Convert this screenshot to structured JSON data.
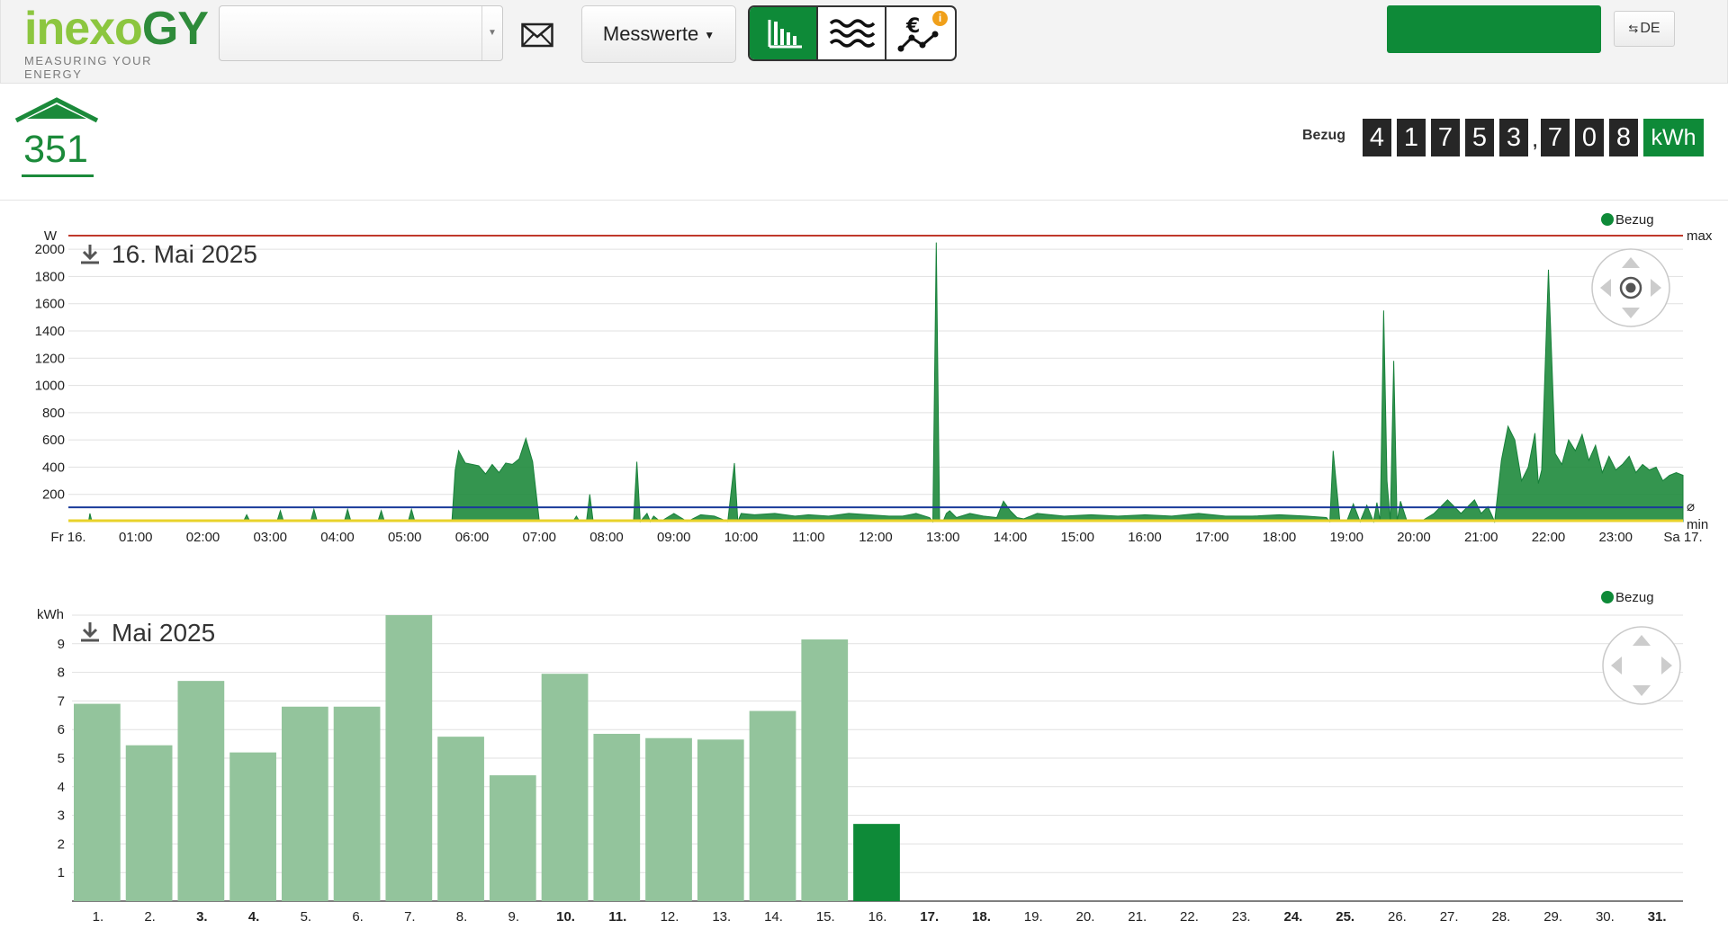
{
  "header": {
    "logo_text_light": "inexo",
    "logo_text_dark": "GY",
    "logo_tagline": "MEASURING YOUR ENERGY",
    "meter_select_value": "",
    "menu_label": "Messwerte",
    "lang_label": "DE",
    "green_button_label": ""
  },
  "meter": {
    "id": "351",
    "counter_label": "Bezug",
    "counter_int_digits": [
      "4",
      "1",
      "7",
      "5",
      "3"
    ],
    "counter_dec_digits": [
      "7",
      "0",
      "8"
    ],
    "counter_unit": "kWh"
  },
  "colors": {
    "brand_green": "#0e8a38",
    "logo_light_green": "#8cc63f",
    "area_fill": "#1e8a3c",
    "bar_light": "#93c49c",
    "bar_current": "#0e8a38",
    "max_line": "#c0392b",
    "avg_line": "#1a3a9a",
    "min_line": "#e8d22a",
    "weekend_red": "#d21f1f"
  },
  "icons": {
    "mail": "envelope-icon",
    "view_bars": "bar-chart-icon",
    "view_waves": "waves-icon",
    "view_cost": "euro-trend-icon",
    "download": "download-icon",
    "pan": "pan-navigator-icon"
  },
  "chart_data": [
    {
      "type": "area",
      "title": "16. Mai 2025",
      "ylabel": "W",
      "ylim": [
        0,
        2100
      ],
      "yticks": [
        200,
        400,
        600,
        800,
        1000,
        1200,
        1400,
        1600,
        1800,
        2000
      ],
      "x_labels": [
        "Fr 16.",
        "01:00",
        "02:00",
        "03:00",
        "04:00",
        "05:00",
        "06:00",
        "07:00",
        "08:00",
        "09:00",
        "10:00",
        "11:00",
        "12:00",
        "13:00",
        "14:00",
        "15:00",
        "16:00",
        "17:00",
        "18:00",
        "19:00",
        "20:00",
        "21:00",
        "22:00",
        "23:00",
        "Sa 17."
      ],
      "legend": [
        "Bezug"
      ],
      "ref_lines": {
        "max_label": "max",
        "avg_label": "⌀",
        "min_label": "min",
        "max_value": 2100,
        "avg_value": 105,
        "min_value": 0
      },
      "grid": true,
      "series": [
        {
          "name": "Bezug",
          "x_hours": [
            0,
            0.3,
            0.32,
            0.35,
            2.6,
            2.65,
            2.7,
            3.1,
            3.15,
            3.2,
            3.6,
            3.65,
            3.7,
            4.1,
            4.15,
            4.2,
            4.6,
            4.65,
            4.7,
            5.05,
            5.1,
            5.15,
            5.7,
            5.75,
            5.8,
            5.9,
            6.0,
            6.1,
            6.2,
            6.3,
            6.4,
            6.5,
            6.6,
            6.7,
            6.8,
            6.9,
            7.0,
            7.05,
            7.5,
            7.55,
            7.6,
            7.7,
            7.75,
            7.8,
            8.4,
            8.45,
            8.5,
            8.6,
            8.65,
            8.7,
            8.8,
            9.0,
            9.2,
            9.4,
            9.6,
            9.8,
            9.9,
            9.95,
            10.0,
            10.2,
            10.5,
            10.8,
            11.0,
            11.3,
            11.6,
            11.9,
            12.2,
            12.4,
            12.6,
            12.8,
            12.85,
            12.9,
            12.95,
            13.0,
            13.05,
            13.1,
            13.2,
            13.4,
            13.6,
            13.8,
            13.9,
            14.0,
            14.1,
            14.2,
            14.4,
            14.8,
            15.2,
            15.6,
            16.0,
            16.4,
            16.8,
            17.2,
            17.6,
            18.0,
            18.4,
            18.7,
            18.75,
            18.8,
            18.9,
            19.0,
            19.1,
            19.2,
            19.3,
            19.4,
            19.45,
            19.5,
            19.55,
            19.6,
            19.65,
            19.7,
            19.75,
            19.8,
            19.9,
            20.1,
            20.3,
            20.5,
            20.7,
            20.9,
            21.0,
            21.1,
            21.2,
            21.3,
            21.4,
            21.5,
            21.6,
            21.7,
            21.8,
            21.85,
            21.9,
            22.0,
            22.1,
            22.2,
            22.3,
            22.4,
            22.5,
            22.6,
            22.7,
            22.8,
            22.9,
            23.0,
            23.1,
            23.2,
            23.3,
            23.4,
            23.5,
            23.6,
            23.7,
            23.8,
            23.9,
            24.0
          ],
          "y_watts": [
            0,
            0,
            60,
            0,
            0,
            50,
            0,
            0,
            80,
            0,
            0,
            90,
            0,
            0,
            90,
            0,
            0,
            80,
            0,
            0,
            90,
            0,
            0,
            380,
            520,
            430,
            420,
            410,
            350,
            420,
            360,
            430,
            420,
            460,
            610,
            440,
            0,
            0,
            0,
            40,
            0,
            0,
            200,
            0,
            0,
            440,
            0,
            60,
            0,
            40,
            0,
            60,
            0,
            50,
            40,
            0,
            430,
            0,
            60,
            50,
            60,
            40,
            50,
            40,
            60,
            50,
            40,
            40,
            60,
            30,
            0,
            2050,
            0,
            0,
            60,
            80,
            30,
            60,
            40,
            30,
            150,
            80,
            30,
            20,
            60,
            40,
            50,
            40,
            50,
            40,
            60,
            40,
            40,
            50,
            40,
            30,
            0,
            520,
            0,
            0,
            130,
            0,
            120,
            0,
            140,
            0,
            1550,
            300,
            0,
            1180,
            0,
            150,
            0,
            0,
            60,
            160,
            60,
            160,
            60,
            110,
            0,
            450,
            700,
            600,
            300,
            400,
            650,
            280,
            380,
            1850,
            500,
            420,
            600,
            520,
            640,
            450,
            560,
            360,
            480,
            380,
            420,
            480,
            360,
            420,
            380,
            400,
            300,
            340,
            360,
            340
          ]
        }
      ]
    },
    {
      "type": "bar",
      "title": "Mai 2025",
      "ylabel": "kWh",
      "ylim": [
        0,
        10
      ],
      "yticks": [
        1,
        2,
        3,
        4,
        5,
        6,
        7,
        8,
        9
      ],
      "legend": [
        "Bezug"
      ],
      "grid": true,
      "categories": [
        "1.",
        "2.",
        "3.",
        "4.",
        "5.",
        "6.",
        "7.",
        "8.",
        "9.",
        "10.",
        "11.",
        "12.",
        "13.",
        "14.",
        "15.",
        "16.",
        "17.",
        "18.",
        "19.",
        "20.",
        "21.",
        "22.",
        "23.",
        "24.",
        "25.",
        "26.",
        "27.",
        "28.",
        "29.",
        "30.",
        "31."
      ],
      "red_categories": [
        "3.",
        "4.",
        "10.",
        "11.",
        "17.",
        "18.",
        "24.",
        "25.",
        "31."
      ],
      "series": [
        {
          "name": "Bezug",
          "values": [
            6.9,
            5.45,
            7.7,
            5.2,
            6.8,
            6.8,
            10.0,
            5.75,
            4.4,
            7.95,
            5.85,
            5.7,
            5.65,
            6.65,
            9.15,
            2.7
          ],
          "current_index": 15
        }
      ]
    }
  ]
}
